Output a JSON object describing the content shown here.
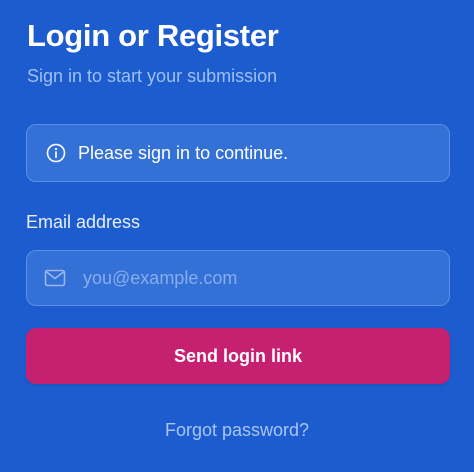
{
  "header": {
    "title": "Login or Register",
    "subtitle": "Sign in to start your submission"
  },
  "notice": {
    "icon": "info-icon",
    "text": "Please sign in to continue."
  },
  "form": {
    "email_label": "Email address",
    "email_icon": "mail-icon",
    "email_value": "",
    "email_placeholder": "you@example.com",
    "submit_label": "Send login link"
  },
  "footer": {
    "forgot_label": "Forgot password?"
  },
  "colors": {
    "background": "#1c5ccf",
    "field_background": "#3471d6",
    "field_border": "#5a8fe2",
    "accent_button": "#c62071",
    "subtitle_text": "#9ec0f2",
    "link_text": "#a9c5f4"
  }
}
